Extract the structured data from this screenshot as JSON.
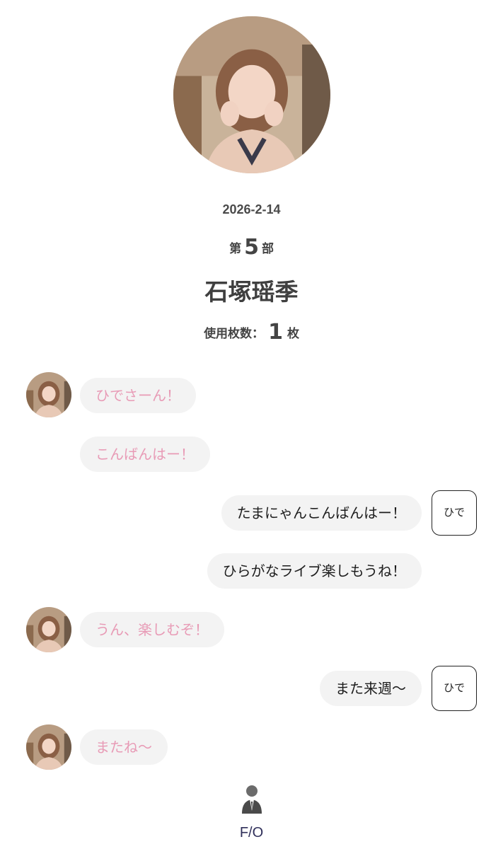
{
  "header": {
    "date": "2026-2-14",
    "part_prefix": "第",
    "part_number": "5",
    "part_suffix": "部",
    "member_name": "石塚瑶季",
    "tickets_label": "使用枚数：",
    "tickets_count": "1",
    "tickets_unit": "枚"
  },
  "user_tag": "ひで",
  "messages": [
    {
      "from": "member",
      "text": "ひでさーん！"
    },
    {
      "from": "member",
      "text": "こんばんはー！"
    },
    {
      "from": "user",
      "text": "たまにゃんこんばんはー！"
    },
    {
      "from": "user",
      "text": "ひらがなライブ楽しもうね！"
    },
    {
      "from": "member",
      "text": "うん、楽しむぞ！"
    },
    {
      "from": "user",
      "text": "また来週〜"
    },
    {
      "from": "member",
      "text": "またね〜"
    }
  ],
  "footer": {
    "label": "F/O",
    "icon": "user-silhouette-icon"
  },
  "colors": {
    "member_text": "#e89bb6",
    "bubble_bg": "#f3f3f3",
    "footer_text": "#2f2f5a"
  }
}
